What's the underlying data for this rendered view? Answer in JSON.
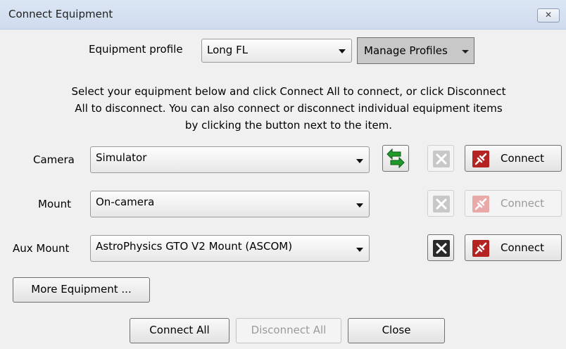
{
  "window": {
    "title": "Connect Equipment",
    "close_glyph": "✕"
  },
  "profile": {
    "label": "Equipment profile",
    "value": "Long FL",
    "manage_label": "Manage Profiles"
  },
  "instructions": [
    "Select your equipment below and click Connect All to connect, or click Disconnect",
    "All to disconnect. You can also connect or disconnect individual equipment items",
    "by clicking the button next to the item."
  ],
  "devices": [
    {
      "label": "Camera",
      "value": "Simulator",
      "connect_label": "Connect",
      "enabled": true
    },
    {
      "label": "Mount",
      "value": "On-camera",
      "connect_label": "Connect",
      "enabled": false
    },
    {
      "label": "Aux Mount",
      "value": "AstroPhysics GTO V2 Mount (ASCOM)",
      "connect_label": "Connect",
      "enabled": true
    }
  ],
  "more_equipment_label": "More Equipment ...",
  "footer": {
    "connect_all": "Connect All",
    "disconnect_all": "Disconnect All",
    "close": "Close"
  },
  "colors": {
    "connect_icon_bg": "#b52222",
    "connect_icon_disabled_bg": "#e9a9a9",
    "swap_icon": "#1f9a2a"
  },
  "icons": {
    "swap": "swap-cameras-icon",
    "setup": "tools-icon",
    "connect": "plug-icon"
  }
}
